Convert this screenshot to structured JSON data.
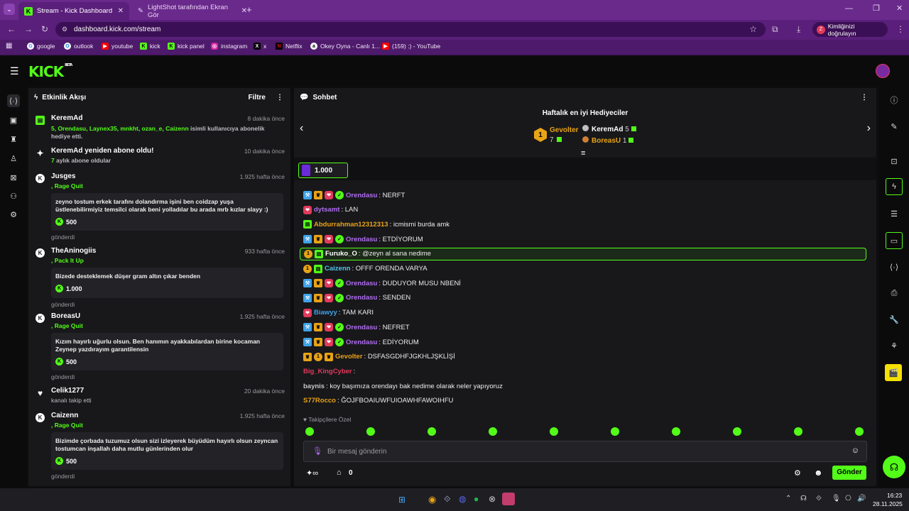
{
  "browser": {
    "tabs": [
      {
        "title": "Stream - Kick Dashboard",
        "active": true
      },
      {
        "title": "LightShot tarafından Ekran Gör",
        "active": false
      }
    ],
    "url": "dashboard.kick.com/stream",
    "profile_label": "Kimliğinizi doğrulayın",
    "bookmarks": [
      "google",
      "outlook",
      "youtube",
      "kick",
      "kick panel",
      "instagram",
      "x",
      "Netflix",
      "Okey Oyna - Canlı 1...",
      "(159) :) - YouTube"
    ]
  },
  "app": {
    "logo": "KICK",
    "logo_tag": "BETA"
  },
  "activity": {
    "title": "Etkinlik Akışı",
    "filter_label": "Filtre",
    "items": [
      {
        "user": "KeremAd",
        "time": "8 dakika önce",
        "sub": "5, Orendasu, Laynex35, mnkht, ozan_e, Caizenn",
        "sub_tail": " isimli kullanıcıya abonelik hediye etti."
      },
      {
        "user": "KeremAd yeniden abone oldu!",
        "time": "10 dakika önce",
        "sub": "7",
        "sub_tail": " aylık abone oldular"
      },
      {
        "user": "Jusges",
        "time": "1.925 hafta önce",
        "reward": ", Rage Quit",
        "message": "zeyno tostum erkek tarafını dolandırma işini ben coidzap yuşa üstlenebilirmiyiz temsilci olarak beni yolladılar bu arada mrb kızlar slayy :)",
        "amount": "500",
        "sent": "gönderdi"
      },
      {
        "user": "TheAninogiis",
        "time": "933 hafta önce",
        "reward": ", Pack It Up",
        "message": "Bizede desteklemek düşer gram altın çıkar benden",
        "amount": "1.000",
        "sent": "gönderdi"
      },
      {
        "user": "BoreasU",
        "time": "1.925 hafta önce",
        "reward": ", Rage Quit",
        "message": "Kızım hayırlı uğurlu olsun. Ben hanımın ayakkabılardan birine kocaman Zeynep yazdırayım garantilensin",
        "amount": "500",
        "sent": "gönderdi"
      },
      {
        "user": "Celik1277",
        "time": "20 dakika önce",
        "sub_plain": "kanalı takip etti"
      },
      {
        "user": "Caizenn",
        "time": "1.925 hafta önce",
        "reward": ", Rage Quit",
        "message": "Bizimde çorbada tuzumuz olsun sizi izleyerek büyüdüm hayırlı olsun zeyncan tostumcan inşallah daha mutlu günlerinden olur",
        "amount": "500",
        "sent": "gönderdi"
      }
    ]
  },
  "chat": {
    "title": "Sohbet",
    "gifters_title": "Haftalık en iyi Hediyeciler",
    "gifters": [
      {
        "rank": "1",
        "name": "Gevolter",
        "count": "7"
      },
      {
        "name": "KeremAd",
        "count": "5"
      },
      {
        "name": "BoreasU",
        "count": "1"
      }
    ],
    "pinned_amount": "1.000",
    "messages": [
      {
        "user": "Orendasu",
        "text": ": NERFT",
        "color": "#b06cf0",
        "badges": [
          "mod",
          "vip",
          "sub",
          "ver"
        ]
      },
      {
        "user": "dytsamt",
        "text": ": LAN",
        "color": "#b06cf0",
        "badges": [
          "sub"
        ]
      },
      {
        "user": "Abdurrahman12312313",
        "text": ": icmismi burda amk",
        "color": "#e8a317",
        "badges": [
          "green"
        ]
      },
      {
        "user": "Orendasu",
        "text": ": ETDİYORUM",
        "color": "#b06cf0",
        "badges": [
          "mod",
          "vip",
          "sub",
          "ver"
        ]
      },
      {
        "user": "Furuko_O",
        "text": ": @zeyn al sana nedime",
        "color": "#ffffff",
        "badges": [
          "gift",
          "green"
        ],
        "highlight": true
      },
      {
        "user": "Caizenn",
        "text": ": OFFF ORENDA VARYA",
        "color": "#53c6e8",
        "badges": [
          "gift",
          "green"
        ]
      },
      {
        "user": "Orendasu",
        "text": ": DUDUYOR MUSU NBENİ",
        "color": "#b06cf0",
        "badges": [
          "mod",
          "vip",
          "sub",
          "ver"
        ]
      },
      {
        "user": "Orendasu",
        "text": ": SENDEN",
        "color": "#b06cf0",
        "badges": [
          "mod",
          "vip",
          "sub",
          "ver"
        ]
      },
      {
        "user": "Biawyy",
        "text": ": TAM KARI",
        "color": "#3fa3e8",
        "badges": [
          "sub"
        ]
      },
      {
        "user": "Orendasu",
        "text": ": NEFRET",
        "color": "#b06cf0",
        "badges": [
          "mod",
          "vip",
          "sub",
          "ver"
        ]
      },
      {
        "user": "Orendasu",
        "text": ": EDİYORUM",
        "color": "#b06cf0",
        "badges": [
          "mod",
          "vip",
          "sub",
          "ver"
        ]
      },
      {
        "user": "Gevolter",
        "text": ": DSFASGDHFJGKHLJŞKLİŞİ",
        "color": "#e8a317",
        "badges": [
          "vip",
          "gift",
          "vip"
        ]
      },
      {
        "user": "Big_KingCyber",
        "text": ":",
        "color": "#e23a5c",
        "badges": []
      },
      {
        "user": "baynis",
        "text": ": koy başımıza orendayı bak nedime olarak neler yapıyoruz",
        "color": "#c8c8c8",
        "badges": []
      },
      {
        "user": "S77Rocco",
        "text": ": ĞOJFBOAIUWFUIOAWHFAWOIHFU",
        "color": "#e8a317",
        "badges": []
      }
    ],
    "followers_only": "Takipçilere Özel",
    "input_placeholder": "Bir mesaj gönderin",
    "points": "0",
    "send_label": "Gönder"
  },
  "taskbar": {
    "time": "16:23",
    "date": "28.11.2025"
  }
}
